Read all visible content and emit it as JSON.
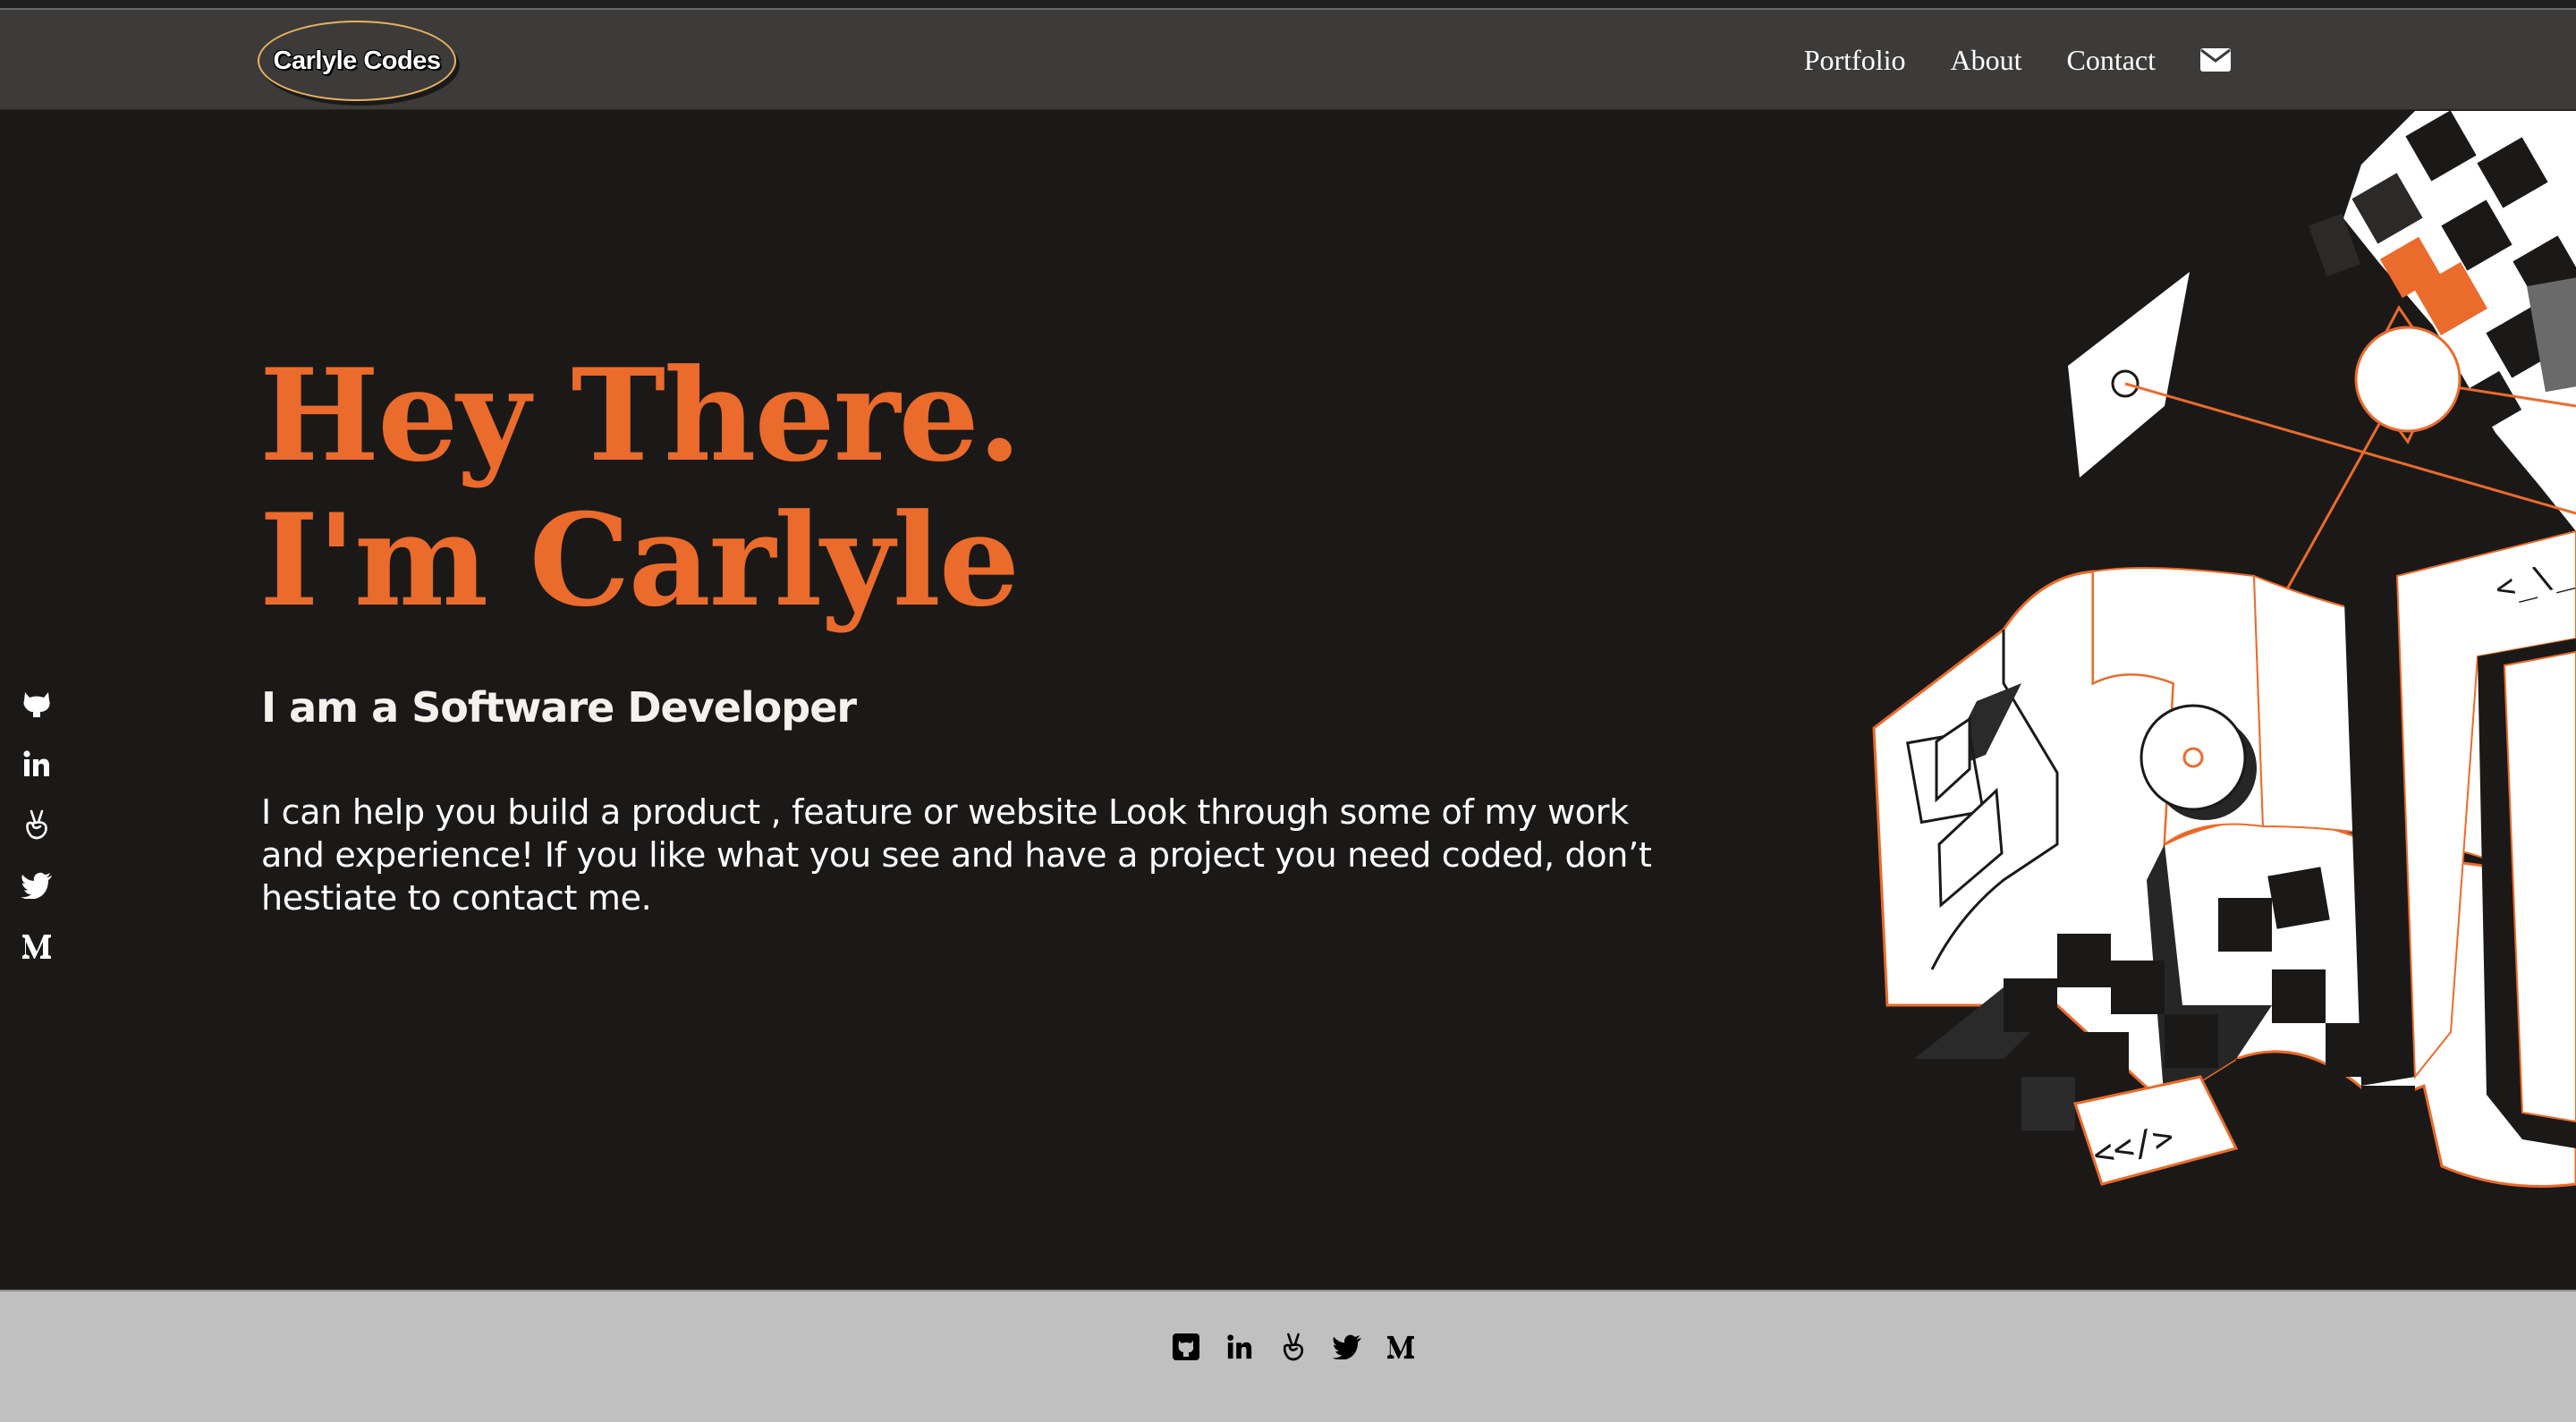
{
  "nav": {
    "logo_text": "Carlyle Codes",
    "links": [
      "Portfolio",
      "About",
      "Contact"
    ],
    "mail_icon": "envelope-icon"
  },
  "hero": {
    "title_line1": "Hey There.",
    "title_line2": "I'm Carlyle",
    "subtitle": "I am a Software Developer",
    "body": "I can help you build a product , feature or website Look through some of my work and experience! If you like what you see and have a project you need coded, don’t hestiate to contact me."
  },
  "social": {
    "side_icons": [
      "github-icon",
      "linkedin-icon",
      "angellist-icon",
      "twitter-icon",
      "medium-icon"
    ],
    "footer_icons": [
      "github-square-icon",
      "linkedin-icon",
      "angellist-icon",
      "twitter-icon",
      "medium-icon"
    ]
  },
  "colors": {
    "accent": "#ea6b2c",
    "navbar": "#3c3b3a",
    "background": "#1b1918",
    "footer": "#c0c0c0",
    "logo_border": "#e9b25c"
  },
  "illustration": {
    "code_tag_1": "<_\\_",
    "code_tag_2": "<</>"
  }
}
